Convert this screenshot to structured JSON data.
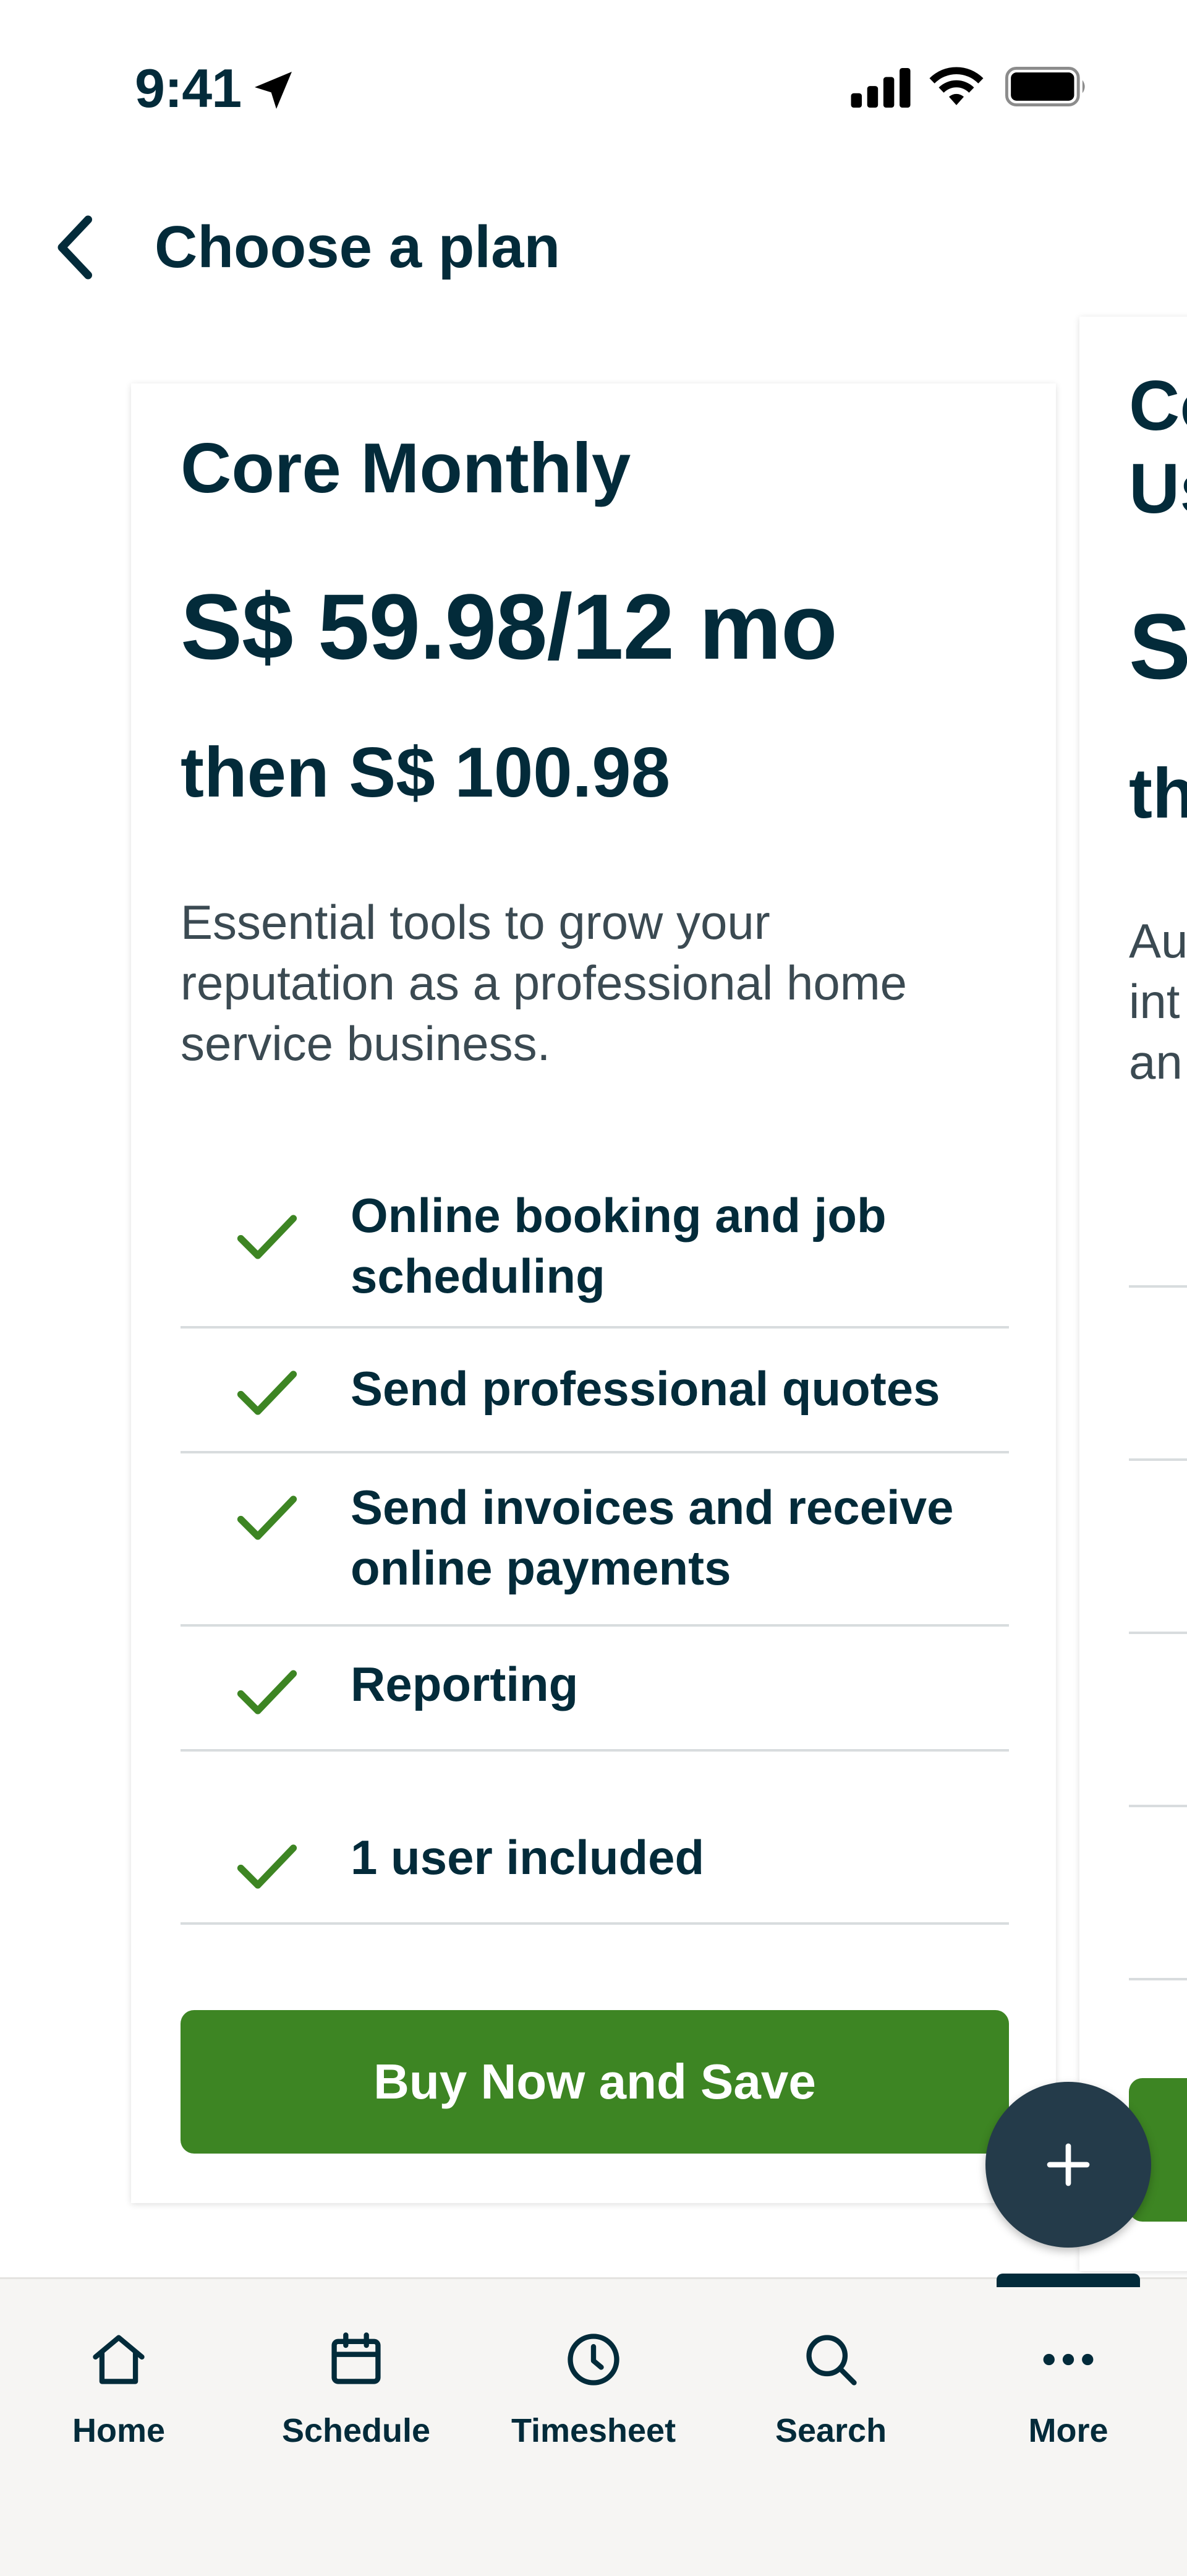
{
  "status_bar": {
    "time": "9:41"
  },
  "header": {
    "title": "Choose a plan"
  },
  "plans": [
    {
      "title": "Core Monthly",
      "price": "S$ 59.98/12 mo",
      "then_price": "then S$ 100.98",
      "description": "Essential tools to grow your reputation as a professional home service business.",
      "features": [
        "Online booking and job scheduling",
        "Send professional quotes",
        "Send invoices and receive online payments",
        "Reporting",
        "1 user included"
      ],
      "cta": "Buy Now and Save"
    },
    {
      "title_partial": [
        "Co",
        "Us"
      ],
      "price_partial": "S",
      "then_partial": "th",
      "description_partial": [
        "Au",
        "int",
        "an"
      ]
    }
  ],
  "fab": {
    "icon": "plus-icon"
  },
  "tabbar": {
    "tabs": [
      {
        "label": "Home",
        "icon": "home-icon"
      },
      {
        "label": "Schedule",
        "icon": "calendar-icon"
      },
      {
        "label": "Timesheet",
        "icon": "clock-icon"
      },
      {
        "label": "Search",
        "icon": "search-icon"
      },
      {
        "label": "More",
        "icon": "more-icon"
      }
    ],
    "active": "More"
  },
  "colors": {
    "primary": "#3d8523",
    "text": "#032b3a",
    "fab": "#243b4a",
    "tabbar_bg": "#f6f5f3"
  }
}
